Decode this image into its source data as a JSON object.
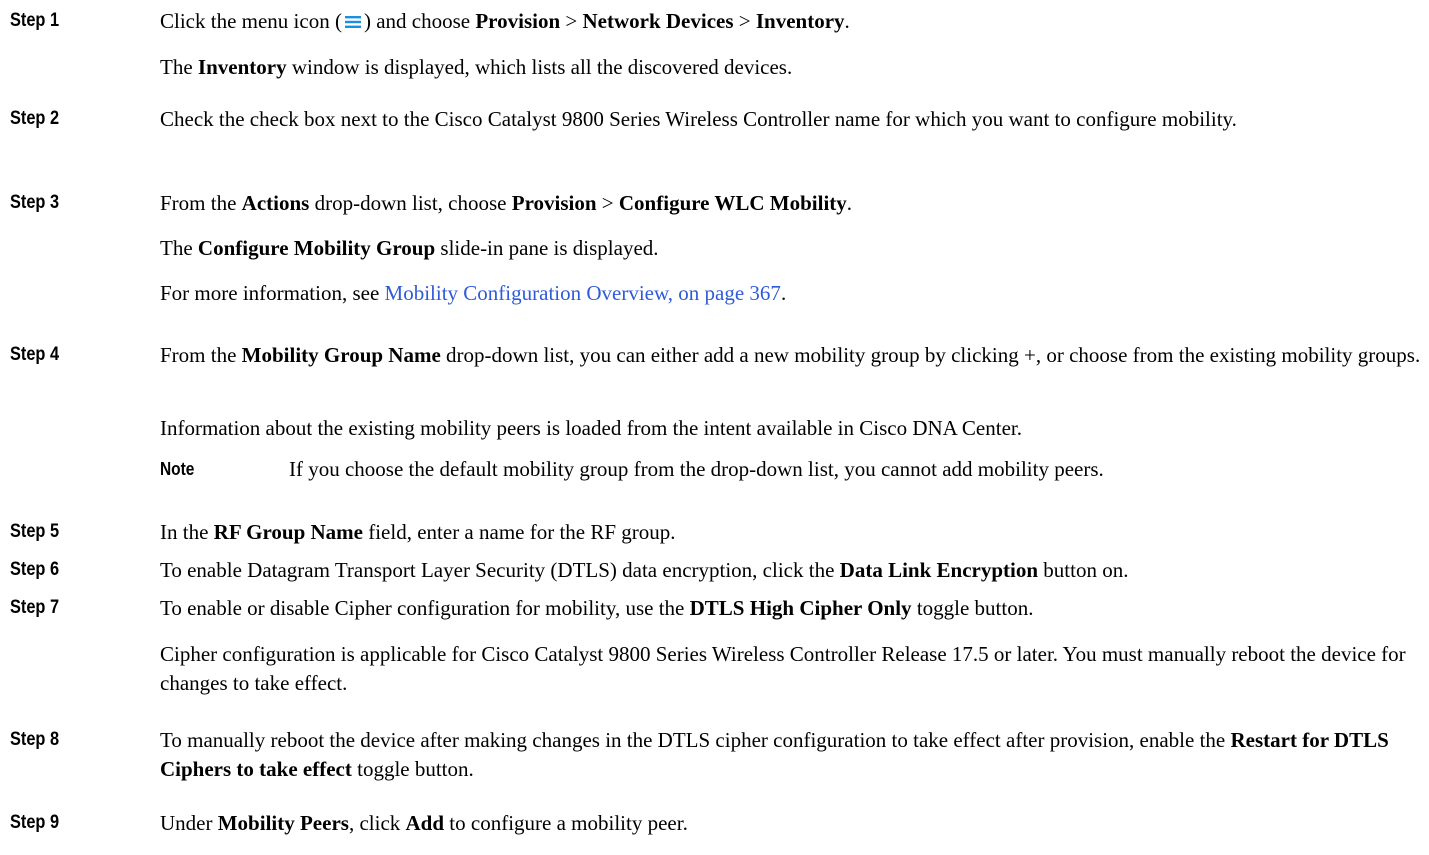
{
  "steps": [
    {
      "label": "Step 1",
      "paragraphs": [
        {
          "p1_a": "Click the menu icon (",
          "p1_b": ") and choose ",
          "p1_c": "Provision",
          "p1_d": " > ",
          "p1_e": "Network Devices",
          "p1_f": " > ",
          "p1_g": "Inventory",
          "p1_h": "."
        },
        {
          "p2_a": "The ",
          "p2_b": "Inventory",
          "p2_c": " window is displayed, which lists all the discovered devices."
        }
      ]
    },
    {
      "label": "Step 2",
      "text": "Check the check box next to the Cisco Catalyst 9800 Series Wireless Controller name for which you want to configure mobility."
    },
    {
      "label": "Step 3",
      "p1_a": "From the ",
      "p1_b": "Actions",
      "p1_c": " drop-down list, choose ",
      "p1_d": "Provision",
      "p1_e": " > ",
      "p1_f": "Configure WLC Mobility",
      "p1_g": ".",
      "p2_a": "The ",
      "p2_b": "Configure Mobility Group",
      "p2_c": " slide-in pane is displayed.",
      "p3_a": "For more information, see ",
      "p3_link": "Mobility Configuration Overview, on page 367",
      "p3_b": "."
    },
    {
      "label": "Step 4",
      "p1_a": "From the ",
      "p1_b": "Mobility Group Name",
      "p1_c": " drop-down list, you can either add a new mobility group by clicking +, or choose from the existing mobility groups.",
      "p2": "Information about the existing mobility peers is loaded from the intent available in Cisco DNA Center.",
      "note_label": "Note",
      "note_text": "If you choose the default mobility group from the drop-down list, you cannot add mobility peers."
    },
    {
      "label": "Step 5",
      "a": "In the ",
      "b": "RF Group Name",
      "c": " field, enter a name for the RF group."
    },
    {
      "label": "Step 6",
      "a": "To enable Datagram Transport Layer Security (DTLS) data encryption, click the ",
      "b": "Data Link Encryption",
      "c": " button on."
    },
    {
      "label": "Step 7",
      "a": "To enable or disable Cipher configuration for mobility, use the ",
      "b": "DTLS High Cipher Only",
      "c": " toggle button.",
      "p2": "Cipher configuration is applicable for Cisco Catalyst 9800 Series Wireless Controller Release 17.5 or later. You must manually reboot the device for changes to take effect."
    },
    {
      "label": "Step 8",
      "a": "To manually reboot the device after making changes in the DTLS cipher configuration to take effect after provision, enable the ",
      "b": "Restart for DTLS Ciphers to take effect",
      "c": " toggle button."
    },
    {
      "label": "Step 9",
      "a": "Under ",
      "b": "Mobility Peers",
      "c": ", click ",
      "d": "Add",
      "e": " to configure a mobility peer."
    }
  ],
  "colors": {
    "link": "#2f5bd9",
    "menu_icon": "#1b8fe0"
  },
  "icons": {
    "menu": "menu-icon"
  }
}
